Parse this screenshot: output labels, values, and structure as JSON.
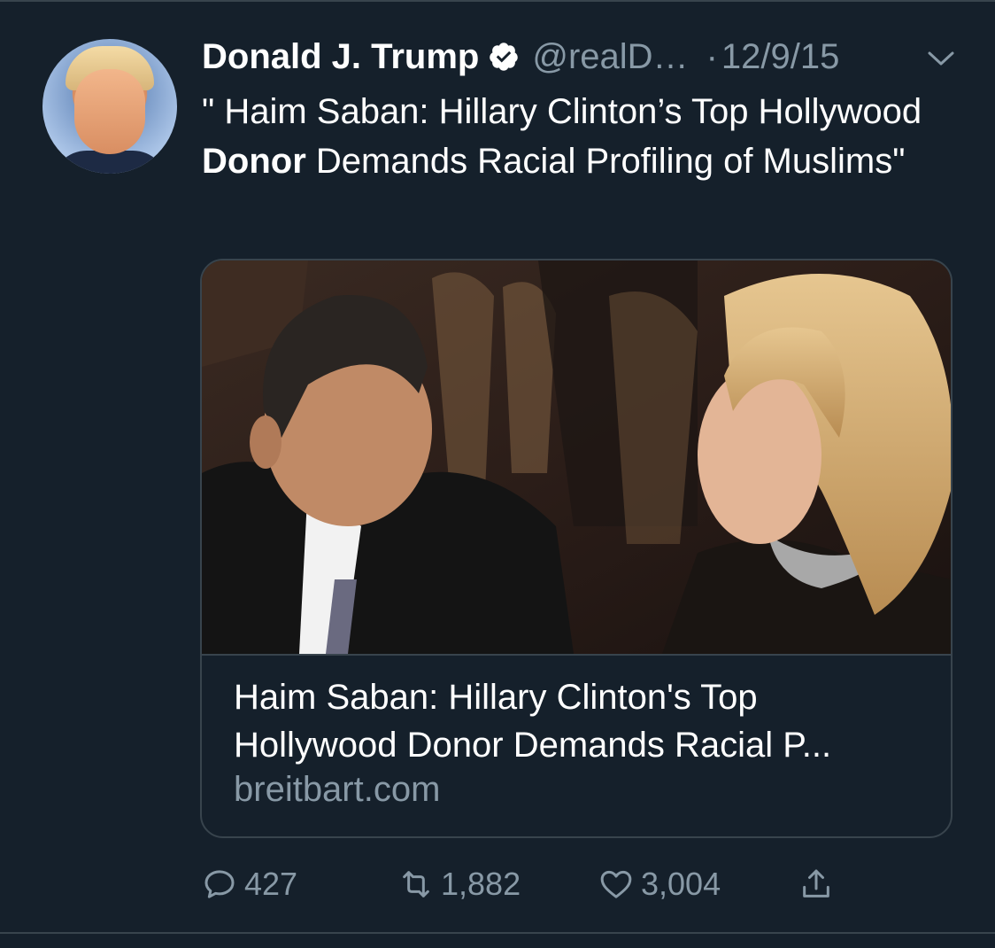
{
  "tweet": {
    "author_name": "Donald J. Trump",
    "handle": "@realD…",
    "separator": "·",
    "date": "12/9/15",
    "text_part1": "\" Haim Saban: Hillary Clinton’s Top Hollywood ",
    "text_bold": "Donor",
    "text_part2": " Demands Racial Profiling of Muslims\""
  },
  "card": {
    "title_line1": "Haim Saban: Hillary Clinton's Top",
    "title_line2": "Hollywood Donor Demands Racial P...",
    "domain": "breitbart.com"
  },
  "actions": {
    "replies": "427",
    "retweets": "1,882",
    "likes": "3,004"
  },
  "colors": {
    "background": "#15202b",
    "secondary_text": "#8899a6",
    "border": "#38444d",
    "text": "#ffffff"
  },
  "icons": {
    "verified": "verified-badge-icon",
    "caret": "chevron-down-icon",
    "reply": "reply-bubble-icon",
    "retweet": "retweet-icon",
    "like": "heart-icon",
    "share": "share-icon"
  }
}
